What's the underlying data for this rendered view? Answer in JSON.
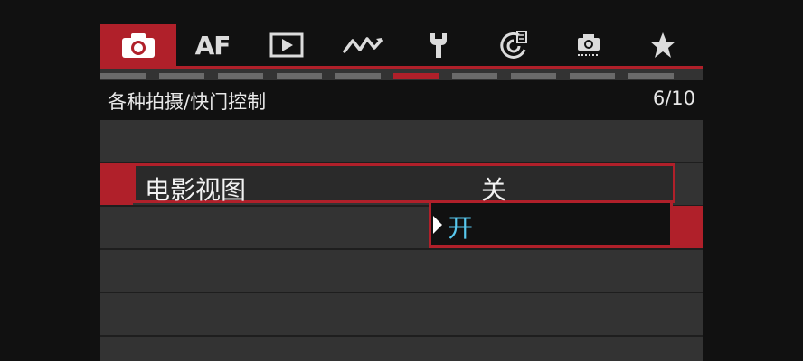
{
  "tabs": [
    {
      "icon": "camera-icon",
      "active": true
    },
    {
      "icon": "af-icon",
      "label": "AF",
      "active": false
    },
    {
      "icon": "playback-icon",
      "active": false
    },
    {
      "icon": "wave-icon",
      "active": false
    },
    {
      "icon": "wrench-icon",
      "active": false
    },
    {
      "icon": "c-dial-icon",
      "active": false
    },
    {
      "icon": "custom-camera-icon",
      "active": false
    },
    {
      "icon": "star-icon",
      "active": false
    }
  ],
  "page_indicator": {
    "count": 10,
    "active_index": 5
  },
  "header": {
    "title": "各种拍摄/快门控制",
    "page": "6/10"
  },
  "setting": {
    "label": "电影视图",
    "options": [
      "关",
      "开"
    ],
    "highlighted_option": "开"
  },
  "colors": {
    "accent": "#b0202a",
    "highlight_text": "#58c8ee",
    "background": "#333333"
  }
}
